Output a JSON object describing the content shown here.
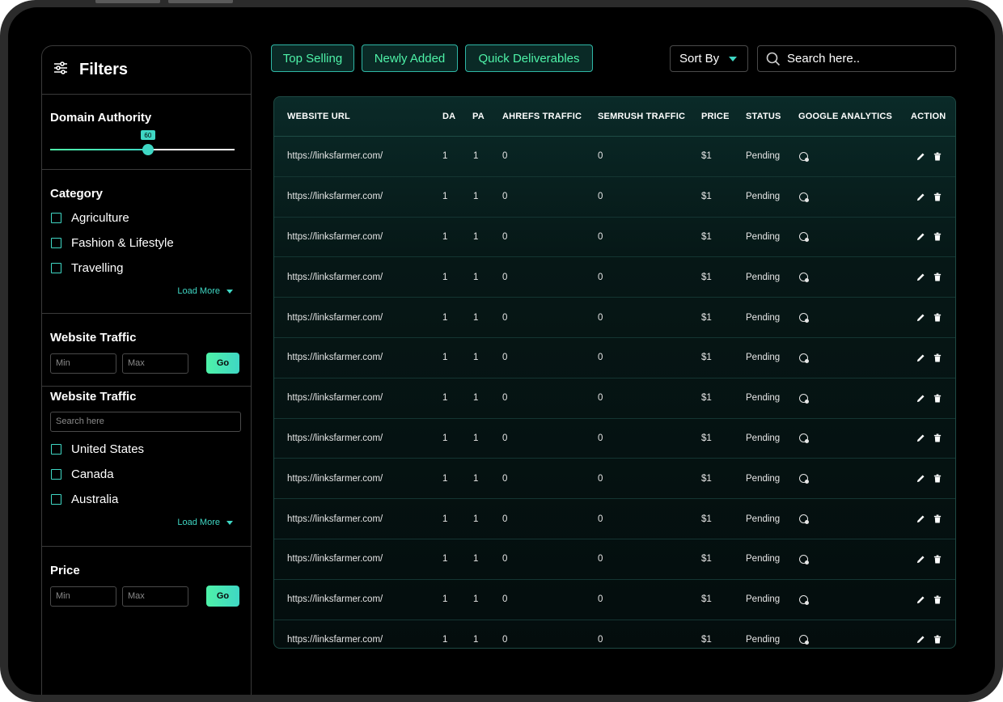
{
  "sidebar": {
    "title": "Filters",
    "domain_authority": {
      "title": "Domain Authority",
      "value": "60",
      "level_percent": 53
    },
    "category": {
      "title": "Category",
      "items": [
        "Agriculture",
        "Fashion & Lifestyle",
        "Travelling"
      ],
      "load_more": "Load More"
    },
    "traffic": {
      "title": "Website Traffic",
      "min_placeholder": "Min",
      "max_placeholder": "Max",
      "go": "Go"
    },
    "country": {
      "title": "Website Traffic",
      "search_placeholder": "Search here",
      "items": [
        "United States",
        "Canada",
        "Australia"
      ],
      "load_more": "Load More"
    },
    "price": {
      "title": "Price",
      "min_placeholder": "Min",
      "max_placeholder": "Max",
      "go": "Go"
    }
  },
  "toolbar": {
    "chips": [
      "Top Selling",
      "Newly Added",
      "Quick Deliverables"
    ],
    "sort_label": "Sort By",
    "search_placeholder": "Search here.."
  },
  "table": {
    "headers": [
      "WEBSITE URL",
      "DA",
      "PA",
      "AHREFS TRAFFIC",
      "SEMRUSH TRAFFIC",
      "PRICE",
      "STATUS",
      "GOOGLE ANALYTICS",
      "ACTION"
    ],
    "rows": [
      {
        "url": "https://linksfarmer.com/",
        "da": "1",
        "pa": "1",
        "ahrefs": "0",
        "semrush": "0",
        "price": "$1",
        "status": "Pending"
      },
      {
        "url": "https://linksfarmer.com/",
        "da": "1",
        "pa": "1",
        "ahrefs": "0",
        "semrush": "0",
        "price": "$1",
        "status": "Pending"
      },
      {
        "url": "https://linksfarmer.com/",
        "da": "1",
        "pa": "1",
        "ahrefs": "0",
        "semrush": "0",
        "price": "$1",
        "status": "Pending"
      },
      {
        "url": "https://linksfarmer.com/",
        "da": "1",
        "pa": "1",
        "ahrefs": "0",
        "semrush": "0",
        "price": "$1",
        "status": "Pending"
      },
      {
        "url": "https://linksfarmer.com/",
        "da": "1",
        "pa": "1",
        "ahrefs": "0",
        "semrush": "0",
        "price": "$1",
        "status": "Pending"
      },
      {
        "url": "https://linksfarmer.com/",
        "da": "1",
        "pa": "1",
        "ahrefs": "0",
        "semrush": "0",
        "price": "$1",
        "status": "Pending"
      },
      {
        "url": "https://linksfarmer.com/",
        "da": "1",
        "pa": "1",
        "ahrefs": "0",
        "semrush": "0",
        "price": "$1",
        "status": "Pending"
      },
      {
        "url": "https://linksfarmer.com/",
        "da": "1",
        "pa": "1",
        "ahrefs": "0",
        "semrush": "0",
        "price": "$1",
        "status": "Pending"
      },
      {
        "url": "https://linksfarmer.com/",
        "da": "1",
        "pa": "1",
        "ahrefs": "0",
        "semrush": "0",
        "price": "$1",
        "status": "Pending"
      },
      {
        "url": "https://linksfarmer.com/",
        "da": "1",
        "pa": "1",
        "ahrefs": "0",
        "semrush": "0",
        "price": "$1",
        "status": "Pending"
      },
      {
        "url": "https://linksfarmer.com/",
        "da": "1",
        "pa": "1",
        "ahrefs": "0",
        "semrush": "0",
        "price": "$1",
        "status": "Pending"
      },
      {
        "url": "https://linksfarmer.com/",
        "da": "1",
        "pa": "1",
        "ahrefs": "0",
        "semrush": "0",
        "price": "$1",
        "status": "Pending"
      },
      {
        "url": "https://linksfarmer.com/",
        "da": "1",
        "pa": "1",
        "ahrefs": "0",
        "semrush": "0",
        "price": "$1",
        "status": "Pending"
      }
    ]
  },
  "colors": {
    "accent": "#3fd7c4",
    "accent_green": "#4ef2a8",
    "background": "#000000"
  }
}
